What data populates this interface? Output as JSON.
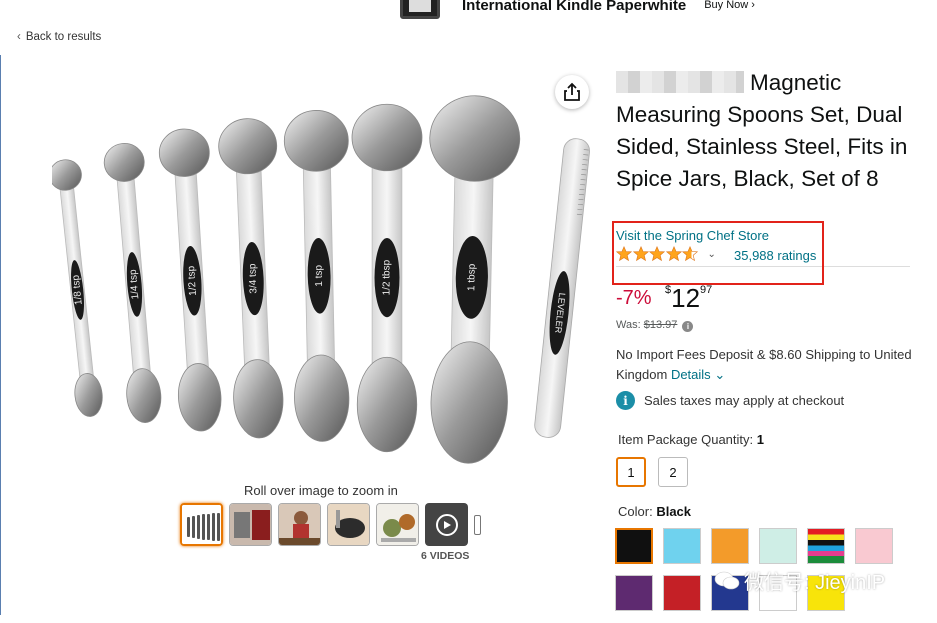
{
  "banner": {
    "title": "International Kindle Paperwhite",
    "buy": "Buy Now ›"
  },
  "nav": {
    "back": "Back to results"
  },
  "product": {
    "title": "Magnetic Measuring Spoons Set, Dual Sided, Stainless Steel, Fits in Spice Jars, Black, Set of 8",
    "store": "Visit the Spring Chef Store",
    "rating_stars": 4.5,
    "ratings": "35,988 ratings",
    "discount": "-7%",
    "price_symbol": "$",
    "price_whole": "12",
    "price_fraction": "97",
    "was_label": "Was:",
    "was_price": "$13.97",
    "shipping": "No Import Fees Deposit & $8.60 Shipping to United Kingdom",
    "details": "Details",
    "tax": "Sales taxes may apply at checkout"
  },
  "quantity": {
    "label": "Item Package Quantity:",
    "selected": "1",
    "options": [
      "1",
      "2"
    ]
  },
  "color": {
    "label": "Color:",
    "selected": "Black",
    "swatches": [
      "#101010",
      "#6fd2ee",
      "#f39b2a",
      "#cfeee6",
      "rainbow",
      "#f9c9d1",
      "#5e2a70",
      "#c42026",
      "#23388f",
      "#ffffff",
      "#f8e40a"
    ]
  },
  "gallery": {
    "zoom_hint": "Roll over image to zoom in",
    "videos": "6 VIDEOS"
  },
  "spoons": [
    "1/8 tsp",
    "1/4 tsp",
    "1/2 tsp",
    "3/4 tsp",
    "1 tsp",
    "1/2 tbsp",
    "1 tbsp",
    "LEVELER"
  ],
  "watermark": "微信号: JieyinIP",
  "colors": {
    "link": "#007185",
    "price_red": "#cc0c39",
    "highlight": "#e2231a",
    "select": "#e77600",
    "star": "#ffa41c"
  },
  "icons": [
    "share-icon",
    "star-icon",
    "chevron-down-icon",
    "info-icon",
    "play-icon",
    "wechat-icon"
  ]
}
